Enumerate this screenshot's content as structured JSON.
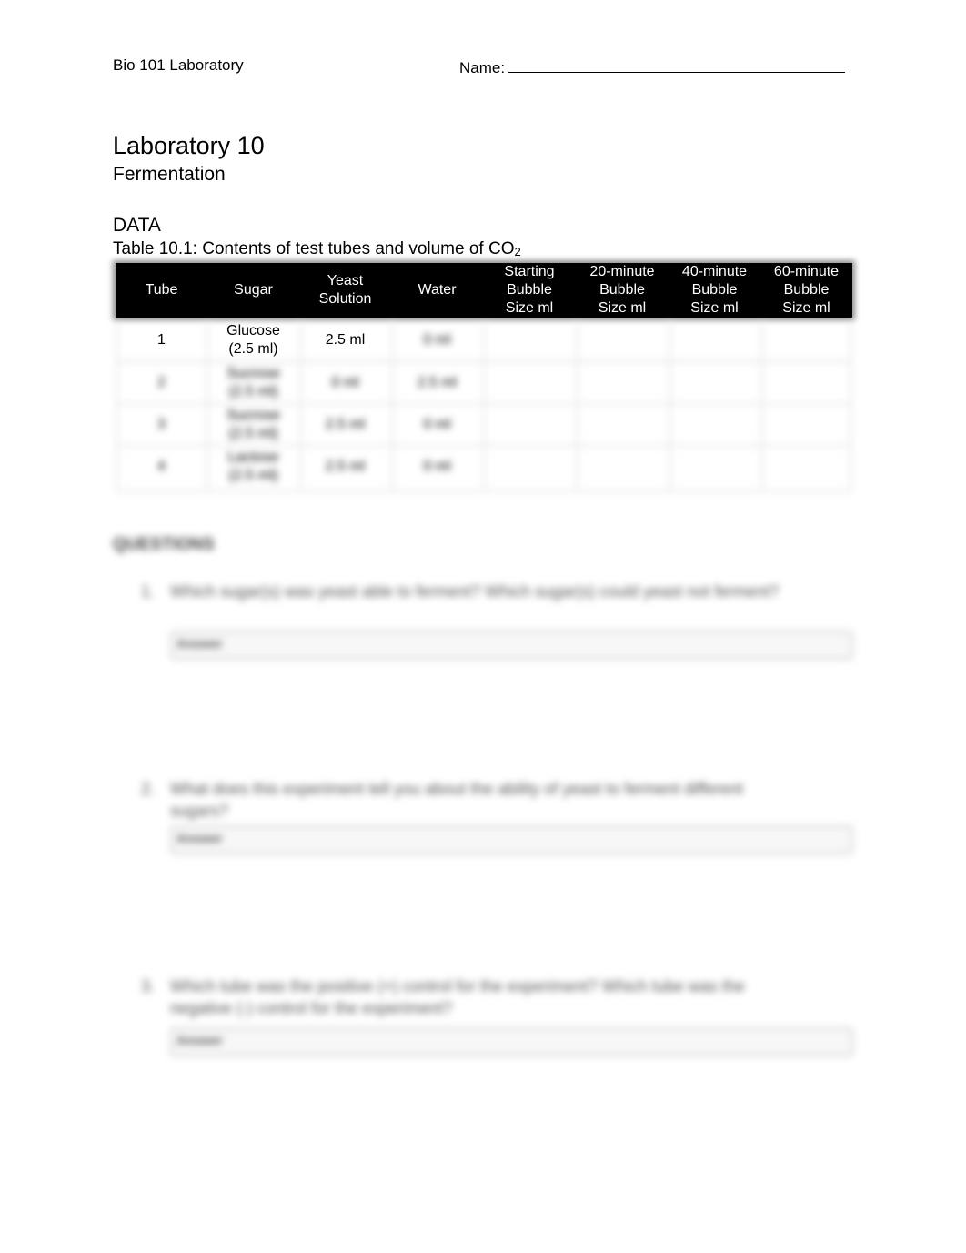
{
  "header": {
    "course": "Bio 101 Laboratory",
    "name_label": "Name:"
  },
  "title": "Laboratory 10",
  "subtitle": "Fermentation",
  "section": "DATA",
  "table": {
    "caption": "Table 10.1: Contents of test tubes and volume of CO",
    "caption_sub": "2",
    "headers": [
      [
        "Tube"
      ],
      [
        "Sugar"
      ],
      [
        "Yeast",
        "Solution"
      ],
      [
        "Water"
      ],
      [
        "Starting",
        "Bubble",
        "Size ml"
      ],
      [
        "20-minute",
        "Bubble",
        "Size ml"
      ],
      [
        "40-minute",
        "Bubble",
        "Size ml"
      ],
      [
        "60-minute",
        "Bubble",
        "Size ml"
      ]
    ],
    "rows": [
      {
        "tube": "1",
        "sugar": [
          "Glucose",
          "(2.5 ml)"
        ],
        "yeast": "2.5 ml",
        "water": "0 ml",
        "start": "",
        "m20": "",
        "m40": "",
        "m60": ""
      },
      {
        "tube": "2",
        "sugar": [
          "Sucrose",
          "(2.5 ml)"
        ],
        "yeast": "0 ml",
        "water": "2.5 ml",
        "start": "",
        "m20": "",
        "m40": "",
        "m60": ""
      },
      {
        "tube": "3",
        "sugar": [
          "Sucrose",
          "(2.5 ml)"
        ],
        "yeast": "2.5 ml",
        "water": "0 ml",
        "start": "",
        "m20": "",
        "m40": "",
        "m60": ""
      },
      {
        "tube": "4",
        "sugar": [
          "Lactose",
          "(2.5 ml)"
        ],
        "yeast": "2.5 ml",
        "water": "0 ml",
        "start": "",
        "m20": "",
        "m40": "",
        "m60": ""
      }
    ]
  },
  "questions": {
    "heading": "QUESTIONS",
    "items": [
      {
        "num": "1.",
        "text": "Which sugar(s) was yeast able to ferment?        Which sugar(s) could yeast not ferment?",
        "answer_label": "Answer"
      },
      {
        "num": "2.",
        "text": "What does this experiment tell you about the ability of yeast to ferment different sugars?",
        "answer_label": "Answer"
      },
      {
        "num": "3.",
        "text": "Which tube was the positive (+) control for the experiment? Which tube was the negative (-) control for the experiment?",
        "answer_label": "Answer"
      }
    ]
  }
}
